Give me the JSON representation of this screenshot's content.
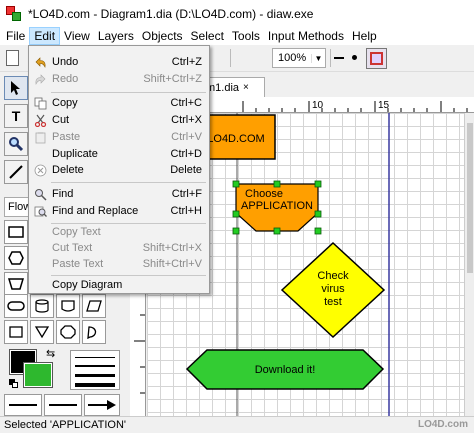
{
  "window": {
    "title": "*LO4D.com - Diagram1.dia (D:\\LO4D.com) - diaw.exe"
  },
  "menubar": [
    "File",
    "Edit",
    "View",
    "Layers",
    "Objects",
    "Select",
    "Tools",
    "Input Methods",
    "Help"
  ],
  "toolbar": {
    "zoom": "100%"
  },
  "edit_menu": [
    {
      "label": "Undo",
      "shortcut": "Ctrl+Z",
      "icon": "undo-icon",
      "enabled": true
    },
    {
      "label": "Redo",
      "shortcut": "Shift+Ctrl+Z",
      "icon": "redo-icon",
      "enabled": false
    },
    {
      "label": "Copy",
      "shortcut": "Ctrl+C",
      "icon": "copy-icon",
      "enabled": true
    },
    {
      "label": "Cut",
      "shortcut": "Ctrl+X",
      "icon": "cut-icon",
      "enabled": true
    },
    {
      "label": "Paste",
      "shortcut": "Ctrl+V",
      "icon": "paste-icon",
      "enabled": false
    },
    {
      "label": "Duplicate",
      "shortcut": "Ctrl+D",
      "icon": "",
      "enabled": true
    },
    {
      "label": "Delete",
      "shortcut": "Delete",
      "icon": "delete-icon",
      "enabled": true
    },
    {
      "label": "Find",
      "shortcut": "Ctrl+F",
      "icon": "find-icon",
      "enabled": true
    },
    {
      "label": "Find and Replace",
      "shortcut": "Ctrl+H",
      "icon": "find-replace-icon",
      "enabled": true
    },
    {
      "label": "Copy Text",
      "shortcut": "",
      "icon": "",
      "enabled": false
    },
    {
      "label": "Cut Text",
      "shortcut": "Shift+Ctrl+X",
      "icon": "",
      "enabled": false
    },
    {
      "label": "Paste Text",
      "shortcut": "Shift+Ctrl+V",
      "icon": "",
      "enabled": false
    },
    {
      "label": "Copy Diagram",
      "shortcut": "",
      "icon": "",
      "enabled": true
    }
  ],
  "document_tab": {
    "label": "m1.dia",
    "close": "×"
  },
  "toolbox": {
    "tools": [
      "T"
    ],
    "sheet": "Flow"
  },
  "ruler": {
    "marks": [
      "10",
      "15"
    ]
  },
  "diagram": {
    "box1": "LO4D.COM",
    "box2": "Choose\nAPPLICATION",
    "diamond": "Check\nvirus\ntest",
    "terminal": "Download it!"
  },
  "colors": {
    "orange": "#ff9f00",
    "yellow": "#ffff00",
    "green": "#33cc33"
  },
  "status": {
    "text": "Selected 'APPLICATION'",
    "watermark": "LO4D.com"
  }
}
